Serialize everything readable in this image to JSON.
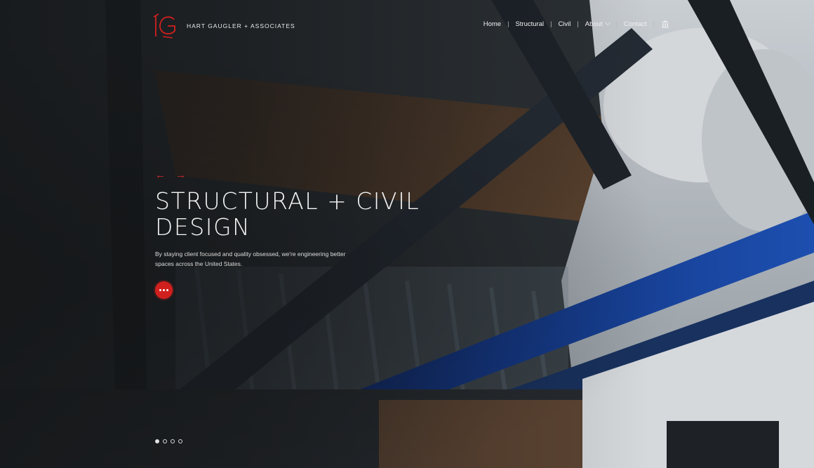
{
  "brand": {
    "name": "HART GAUGLER + ASSOCIATES",
    "accent_color": "#d0201e"
  },
  "nav": {
    "items": [
      {
        "label": "Home"
      },
      {
        "label": "Structural"
      },
      {
        "label": "Civil"
      },
      {
        "label": "About",
        "has_dropdown": true
      },
      {
        "label": "Contact"
      }
    ],
    "separator": "|",
    "icon": "building-icon"
  },
  "hero": {
    "prev_arrow": "←",
    "next_arrow": "→",
    "headline": "STRUCTURAL + CIVIL DESIGN",
    "lede": "By staying client focused and quality obsessed, we're engineering better spaces across the United States.",
    "more_icon": "ellipsis-icon",
    "slides_total": 4,
    "slide_active": 1
  }
}
